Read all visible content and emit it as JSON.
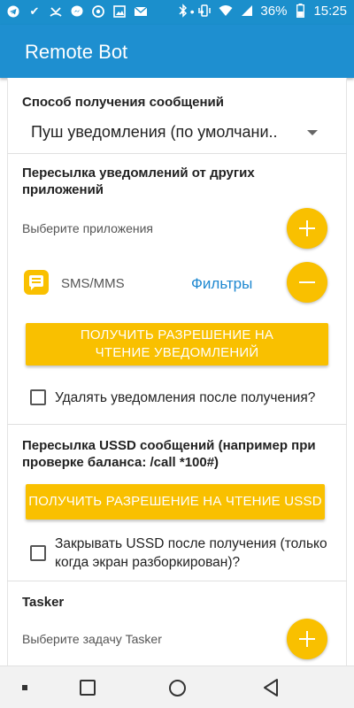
{
  "status_bar": {
    "left_icons": [
      "telegram-icon",
      "check-icon",
      "missed-call-icon",
      "messenger-icon",
      "app-icon",
      "image-icon",
      "mail-icon"
    ],
    "dots": "• • •",
    "battery": "36%",
    "time": "15:25"
  },
  "app_bar": {
    "title": "Remote Bot"
  },
  "receive": {
    "title": "Способ получения сообщений",
    "selected": "Пуш уведомления (по умолчани.."
  },
  "forward_notifications": {
    "title": "Пересылка уведомлений от других приложений",
    "choose_apps": "Выберите приложения",
    "app_name": "SMS/MMS",
    "filters_link": "Фильтры",
    "permission_button": "ПОЛУЧИТЬ РАЗРЕШЕНИЕ НА ЧТЕНИЕ УВЕДОМЛЕНИЙ",
    "delete_checkbox_label": "Удалять уведомления после получения?"
  },
  "ussd": {
    "title": "Пересылка USSD сообщений (например при проверке баланса: /call *100#)",
    "permission_button": "ПОЛУЧИТЬ РАЗРЕШЕНИЕ НА ЧТЕНИЕ USSD",
    "close_checkbox_label": "Закрывать USSD после получения (только когда экран разборкирован)?"
  },
  "tasker": {
    "title": "Tasker",
    "choose_task": "Выберите задачу Tasker"
  },
  "colors": {
    "primary": "#1e8fd0",
    "accent": "#f9c000",
    "link": "#1e88d0"
  }
}
